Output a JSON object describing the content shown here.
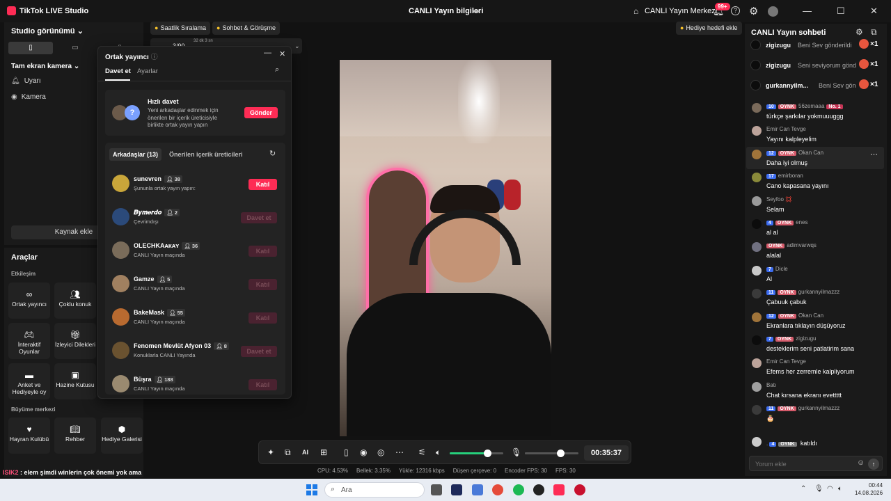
{
  "app": {
    "title": "TikTok LIVE Studio",
    "center_title": "CANLI Yayın bilgileri",
    "live_center": "CANLI Yayın Merkezi",
    "notif_count": "99+"
  },
  "left": {
    "title": "Studio görünümü",
    "camera_mode": "Tam ekran kamera",
    "items": [
      "Uyarı",
      "Kamera"
    ],
    "add_source": "Kaynak ekle"
  },
  "tools": {
    "title": "Araçlar",
    "section_interaction": "Etkileşim",
    "interaction": [
      "Ortak yayıncı",
      "Çoklu konuk",
      "İnteraktif Oyunlar",
      "İzleyici Dilekleri",
      "Anket ve Hediyeyle oy",
      "Hazine Kutusu"
    ],
    "section_growth": "Büyüme merkezi",
    "growth": [
      "Hayran Kulübü",
      "Rehber",
      "Hediye Galerisi"
    ]
  },
  "pills": {
    "ranking": "Saatlik Sıralama",
    "chat": "Sohbet & Görüşme",
    "goal": "Hediye hedefi ekle",
    "progress": "3/90",
    "time_left": "32 dk 3 sn"
  },
  "modal": {
    "title": "Ortak yayıncı",
    "tabs": [
      "Davet et",
      "Ayarlar"
    ],
    "quick": {
      "title": "Hızlı davet",
      "desc": "Yeni arkadaşlar edinmek için önerilen bir içerik üreticisiyle birlikte ortak yayın yapın",
      "button": "Gönder"
    },
    "friend_tabs": [
      "Arkadaşlar (13)",
      "Önerilen içerik üreticileri"
    ],
    "friends": [
      {
        "name": "sunevren",
        "count": "38",
        "status": "Şununla ortak yayın yapın:",
        "action": "Katıl",
        "active": true
      },
      {
        "name": "𝑩𝒚𝒎𝒆𝒓𝒅𝒐",
        "count": "2",
        "status": "Çevrimdışı",
        "action": "Davet et",
        "active": false
      },
      {
        "name": "OLECHKAᴀᴋᴀʏ",
        "count": "36",
        "status": "CANLI Yayın maçında",
        "action": "Katıl",
        "active": false
      },
      {
        "name": "Gamze",
        "count": "5",
        "status": "CANLI Yayın maçında",
        "action": "Katıl",
        "active": false
      },
      {
        "name": "BakeMask",
        "count": "55",
        "status": "CANLI Yayın maçında",
        "action": "Katıl",
        "active": false
      },
      {
        "name": "Fenomen Mevlüt Afyon 03",
        "count": "8",
        "status": "Konuklarla CANLI Yayında",
        "action": "Davet et",
        "active": false
      },
      {
        "name": "Büşra",
        "count": "188",
        "status": "CANLI Yayın maçında",
        "action": "Katıl",
        "active": false
      }
    ]
  },
  "controls": {
    "timer": "00:35:37",
    "volume_level": 0.7,
    "mic_level": 0.66
  },
  "stats": [
    "CPU: 4.53%",
    "Bellek: 3.35%",
    "Yükle: 12316 kbps",
    "Düşen çerçeve: 0",
    "Encoder FPS: 30",
    "FPS: 30"
  ],
  "ticker": {
    "name": "ISIK2",
    "text": " : elem şimdi winlerin çok önemi yok ama"
  },
  "chat": {
    "title": "CANLI Yayın sohbeti",
    "gifts": [
      {
        "name": "zigizugu",
        "text": "Beni Sev gönderildi",
        "mult": "×1"
      },
      {
        "name": "zigizugu",
        "text": "Seni seviyorum gönd",
        "mult": "×1"
      },
      {
        "name": "gurkannyilm...",
        "text": "Beni Sev göndi",
        "mult": "×1"
      }
    ],
    "messages": [
      {
        "lvl": "10",
        "fan": "OYNK",
        "user": "56zemaaa",
        "badge": "No. 1",
        "text": "türkçe şarkılar yokmuuuggg"
      },
      {
        "lvl": "",
        "fan": "",
        "user": "Emir Can Tevge",
        "badge": "",
        "text": "Yayını kalpleyelim"
      },
      {
        "lvl": "12",
        "fan": "OYNK",
        "user": "Okan Can",
        "badge": "",
        "text": "Daha iyi olmuş"
      },
      {
        "lvl": "17",
        "fan": "",
        "user": "emirboran",
        "badge": "",
        "text": "Cano kapasana yayını"
      },
      {
        "lvl": "",
        "fan": "",
        "user": "Seyfoo 💢",
        "badge": "",
        "text": "Selam"
      },
      {
        "lvl": "4",
        "fan": "OYNK",
        "user": "enes",
        "badge": "",
        "text": "al al"
      },
      {
        "lvl": "",
        "fan": "OYNK",
        "user": "adimvarwqs",
        "badge": "",
        "text": "alalal"
      },
      {
        "lvl": "7",
        "fan": "",
        "user": "Dicle",
        "badge": "",
        "text": "Al"
      },
      {
        "lvl": "11",
        "fan": "OYNK",
        "user": "gurkannyilmazzz",
        "badge": "",
        "text": "Çabuuk çabuk"
      },
      {
        "lvl": "12",
        "fan": "OYNK",
        "user": "Okan Can",
        "badge": "",
        "text": "Ekranlara tıklayın düşüyoruz"
      },
      {
        "lvl": "7",
        "fan": "OYNK",
        "user": "zigizugu",
        "badge": "",
        "text": "desteklerim seni patlatirim sana"
      },
      {
        "lvl": "",
        "fan": "",
        "user": "Emir Can Tevge",
        "badge": "",
        "text": "Efems her zerremle kalpliyorum"
      },
      {
        "lvl": "",
        "fan": "",
        "user": "Batı",
        "badge": "",
        "text": "Chat kırsana ekranı evettttt"
      },
      {
        "lvl": "11",
        "fan": "OYNK",
        "user": "gurkannyilmazzz",
        "badge": "",
        "text": "🎂"
      }
    ],
    "joined": {
      "name": ".",
      "lvl": "4",
      "fan": "OYNK",
      "text": "katıldı"
    },
    "input_placeholder": "Yorum ekle"
  },
  "taskbar": {
    "search": "Ara",
    "time": "00:44",
    "date": "14.08.2026"
  }
}
